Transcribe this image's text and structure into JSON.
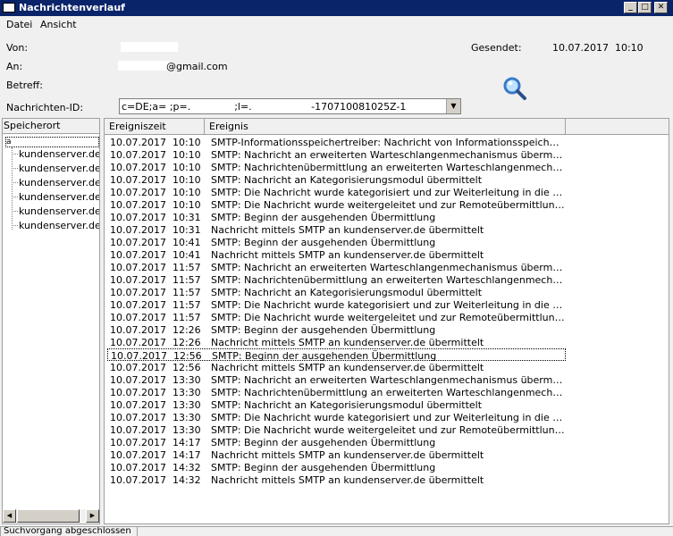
{
  "window": {
    "title": "Nachrichtenverlauf",
    "minimize": "_",
    "maximize": "□",
    "close": "✕"
  },
  "menu": {
    "datei": "Datei",
    "ansicht": "Ansicht"
  },
  "header": {
    "von_label": "Von:",
    "an_label": "An:",
    "an_value": "@gmail.com",
    "betreff_label": "Betreff:",
    "gesendet_label": "Gesendet:",
    "gesendet_value": "10.07.2017  10:10",
    "nachrichten_id_label": "Nachrichten-ID:",
    "nachrichten_id_value": "c=DE;a= ;p=.              ;l=.                   -170710081025Z-1",
    "search_icon": "magnifier-icon"
  },
  "left_pane": {
    "header": "Speicherort",
    "root": "a",
    "items": [
      "kundenserver.de",
      "kundenserver.de",
      "kundenserver.de",
      "kundenserver.de",
      "kundenserver.de",
      "kundenserver.de"
    ]
  },
  "list": {
    "col_time": "Ereigniszeit",
    "col_event": "Ereignis",
    "rows": [
      {
        "time": "10.07.2017  10:10",
        "event": "SMTP-Informationsspeichertreiber: Nachricht von Informationsspeicher übermittelt"
      },
      {
        "time": "10.07.2017  10:10",
        "event": "SMTP: Nachricht an erweiterten Warteschlangenmechanismus übermittelt"
      },
      {
        "time": "10.07.2017  10:10",
        "event": "SMTP: Nachrichtenübermittlung an erweiterten Warteschlangenmechanismus begonnen"
      },
      {
        "time": "10.07.2017  10:10",
        "event": "SMTP: Nachricht an Kategorisierungsmodul übermittelt"
      },
      {
        "time": "10.07.2017  10:10",
        "event": "SMTP: Die Nachricht wurde kategorisiert und zur Weiterleitung in die Warteschlange gestellt"
      },
      {
        "time": "10.07.2017  10:10",
        "event": "SMTP: Die Nachricht wurde weitergeleitet und zur Remoteübermittlung in die Warteschlange gestellt"
      },
      {
        "time": "10.07.2017  10:31",
        "event": "SMTP: Beginn der ausgehenden Übermittlung"
      },
      {
        "time": "10.07.2017  10:31",
        "event": "Nachricht  mittels SMTP an kundenserver.de übermittelt"
      },
      {
        "time": "10.07.2017  10:41",
        "event": "SMTP: Beginn der ausgehenden Übermittlung"
      },
      {
        "time": "10.07.2017  10:41",
        "event": "Nachricht  mittels SMTP an kundenserver.de übermittelt"
      },
      {
        "time": "10.07.2017  11:57",
        "event": "SMTP: Nachricht an erweiterten Warteschlangenmechanismus übermittelt"
      },
      {
        "time": "10.07.2017  11:57",
        "event": "SMTP: Nachrichtenübermittlung an erweiterten Warteschlangenmechanismus begonnen"
      },
      {
        "time": "10.07.2017  11:57",
        "event": "SMTP: Nachricht an Kategorisierungsmodul übermittelt"
      },
      {
        "time": "10.07.2017  11:57",
        "event": "SMTP: Die Nachricht wurde kategorisiert und zur Weiterleitung in die Warteschlange gestellt"
      },
      {
        "time": "10.07.2017  11:57",
        "event": "SMTP: Die Nachricht wurde weitergeleitet und zur Remoteübermittlung in die Warteschlange gestellt"
      },
      {
        "time": "10.07.2017  12:26",
        "event": "SMTP: Beginn der ausgehenden Übermittlung"
      },
      {
        "time": "10.07.2017  12:26",
        "event": "Nachricht  mittels SMTP an kundenserver.de übermittelt"
      },
      {
        "time": "10.07.2017  12:56",
        "event": "SMTP: Beginn der ausgehenden Übermittlung"
      },
      {
        "time": "10.07.2017  12:56",
        "event": "Nachricht  mittels SMTP an kundenserver.de übermittelt"
      },
      {
        "time": "10.07.2017  13:30",
        "event": "SMTP: Nachricht an erweiterten Warteschlangenmechanismus übermittelt"
      },
      {
        "time": "10.07.2017  13:30",
        "event": "SMTP: Nachrichtenübermittlung an erweiterten Warteschlangenmechanismus begonnen"
      },
      {
        "time": "10.07.2017  13:30",
        "event": "SMTP: Nachricht an Kategorisierungsmodul übermittelt"
      },
      {
        "time": "10.07.2017  13:30",
        "event": "SMTP: Die Nachricht wurde kategorisiert und zur Weiterleitung in die Warteschlange gestellt"
      },
      {
        "time": "10.07.2017  13:30",
        "event": "SMTP: Die Nachricht wurde weitergeleitet und zur Remoteübermittlung in die Warteschlange gestellt"
      },
      {
        "time": "10.07.2017  14:17",
        "event": "SMTP: Beginn der ausgehenden Übermittlung"
      },
      {
        "time": "10.07.2017  14:17",
        "event": "Nachricht  mittels SMTP an kundenserver.de übermittelt"
      },
      {
        "time": "10.07.2017  14:32",
        "event": "SMTP: Beginn der ausgehenden Übermittlung"
      },
      {
        "time": "10.07.2017  14:32",
        "event": "Nachricht  mittels SMTP an kundenserver.de übermittelt"
      }
    ]
  },
  "status": {
    "text": "Suchvorgang abgeschlossen"
  }
}
